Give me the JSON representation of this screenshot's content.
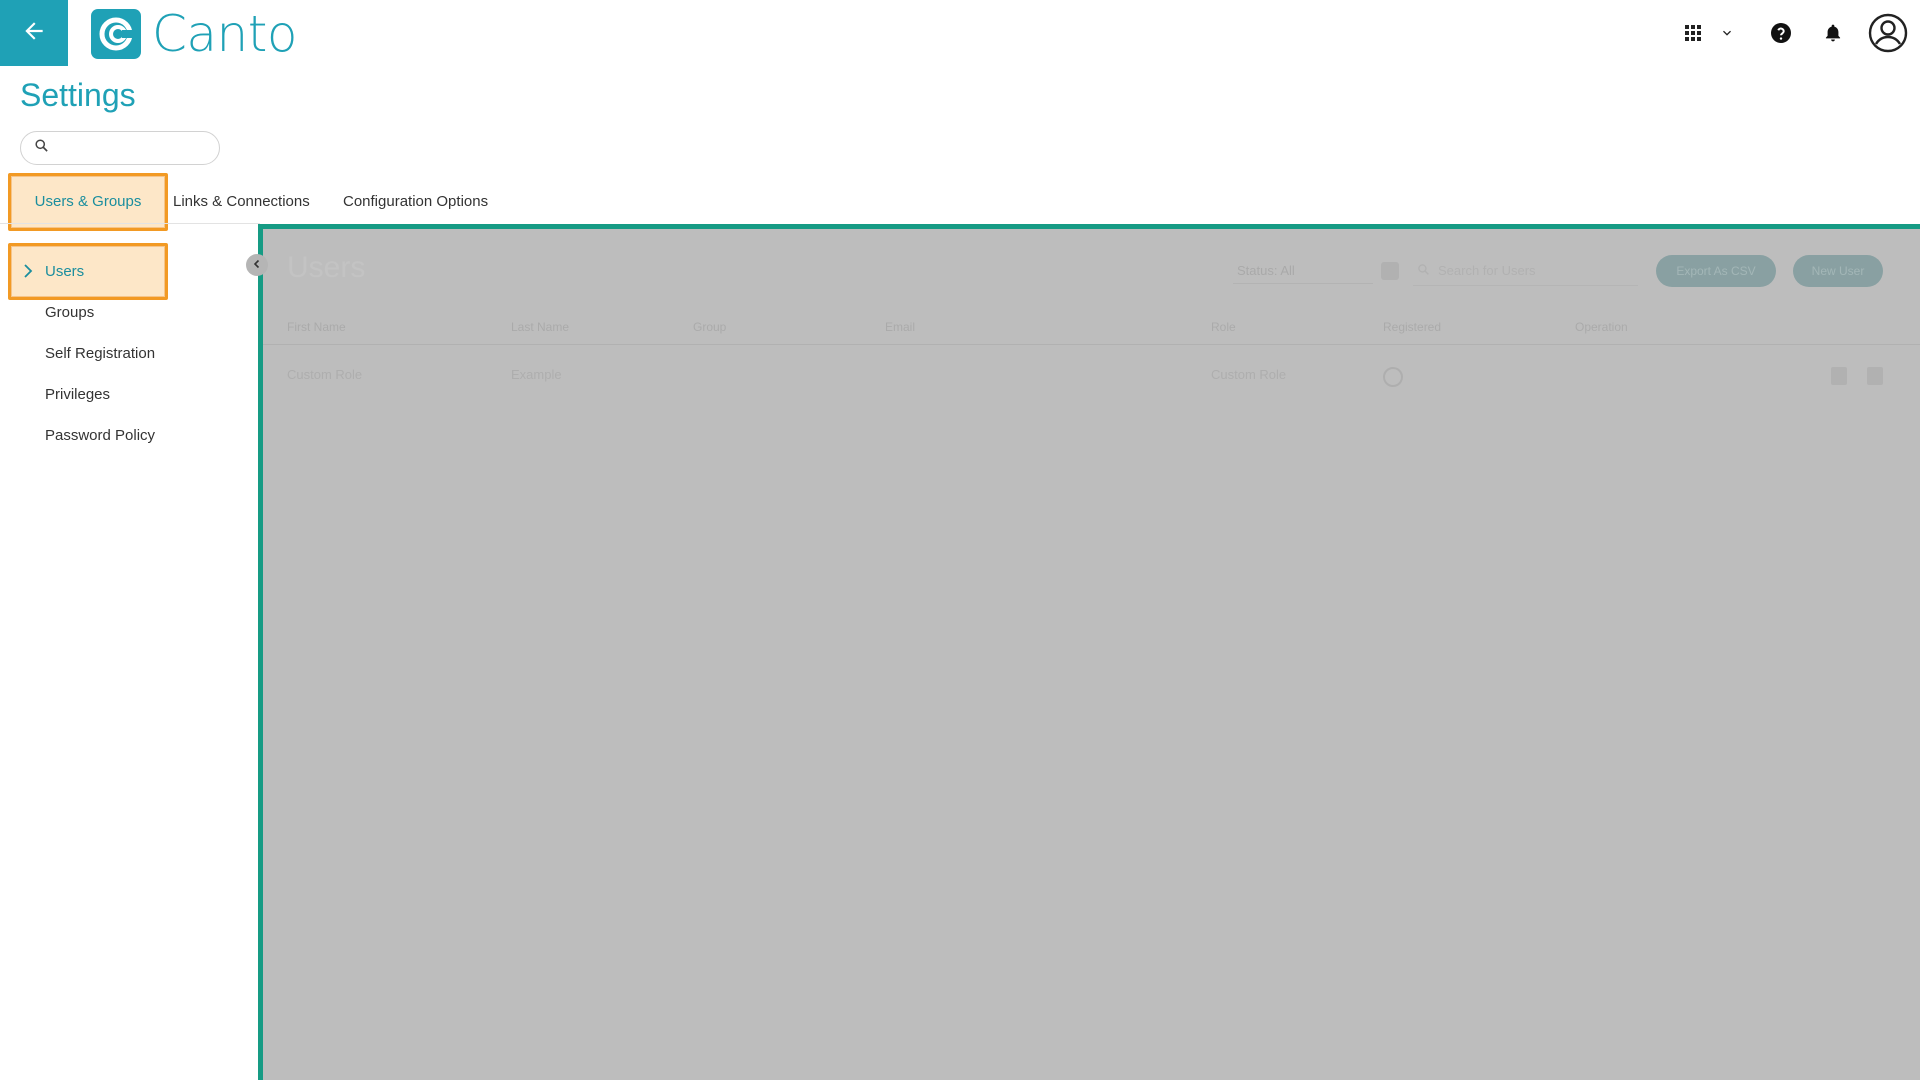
{
  "app": {
    "brand": "Canto",
    "accent_color": "#1fa1b6",
    "highlight_border": "#f29a24",
    "frame_color": "#169b84"
  },
  "header": {
    "back_icon": "arrow-left-icon",
    "icons": [
      "apps-grid-icon",
      "chevron-down-icon",
      "help-icon",
      "bell-icon",
      "account-icon"
    ]
  },
  "page": {
    "title": "Settings",
    "search": {
      "placeholder": "",
      "value": ""
    }
  },
  "tabs": [
    {
      "label": "Users & Groups",
      "active": true
    },
    {
      "label": "Links & Connections",
      "active": false
    },
    {
      "label": "Configuration Options",
      "active": false
    }
  ],
  "sidebar": {
    "items": [
      {
        "label": "Users",
        "active": true
      },
      {
        "label": "Groups",
        "active": false
      },
      {
        "label": "Self Registration",
        "active": false
      },
      {
        "label": "Privileges",
        "active": false
      },
      {
        "label": "Password Policy",
        "active": false
      }
    ]
  },
  "main": {
    "title": "Users",
    "status_filter": "Status: All",
    "search_placeholder": "Search for Users",
    "export_button": "Export As CSV",
    "new_button": "New User",
    "columns": [
      "First Name",
      "Last Name",
      "Group",
      "Email",
      "Role",
      "Registered",
      "Operation"
    ],
    "rows": [
      {
        "first_name": "Custom Role",
        "last_name": "Example",
        "group": "",
        "email": "",
        "role": "Custom Role",
        "registered": "clock-icon"
      }
    ]
  }
}
